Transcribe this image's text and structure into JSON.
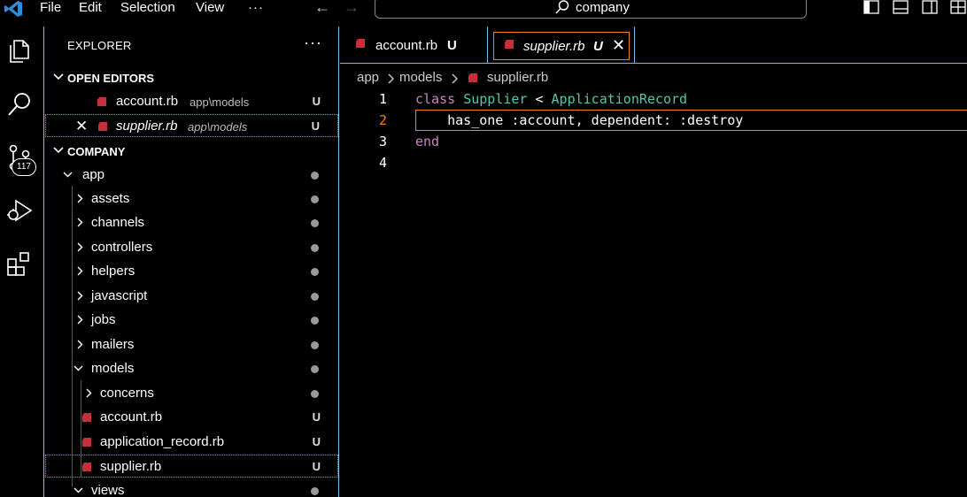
{
  "menu": {
    "items": [
      "File",
      "Edit",
      "Selection",
      "View"
    ],
    "more": "···"
  },
  "search": {
    "text": "company"
  },
  "activity": {
    "source_control_badge": "117"
  },
  "sidebar": {
    "title": "EXPLORER",
    "more": "···",
    "open_editors": {
      "label": "OPEN EDITORS",
      "items": [
        {
          "name": "account.rb",
          "path": "app\\models",
          "status": "U"
        },
        {
          "name": "supplier.rb",
          "path": "app\\models",
          "status": "U"
        }
      ]
    },
    "project": {
      "label": "COMPANY",
      "tree": [
        {
          "name": "app"
        },
        {
          "name": "assets"
        },
        {
          "name": "channels"
        },
        {
          "name": "controllers"
        },
        {
          "name": "helpers"
        },
        {
          "name": "javascript"
        },
        {
          "name": "jobs"
        },
        {
          "name": "mailers"
        },
        {
          "name": "models"
        },
        {
          "name": "concerns"
        },
        {
          "name": "account.rb",
          "status": "U"
        },
        {
          "name": "application_record.rb",
          "status": "U"
        },
        {
          "name": "supplier.rb",
          "status": "U"
        },
        {
          "name": "views"
        }
      ]
    }
  },
  "editor": {
    "tabs": [
      {
        "label": "account.rb",
        "status": "U"
      },
      {
        "label": "supplier.rb",
        "status": "U",
        "close": "✕"
      }
    ],
    "breadcrumb": [
      "app",
      "models",
      "supplier.rb"
    ],
    "line_numbers": [
      "1",
      "2",
      "3",
      "4"
    ],
    "code": {
      "l1_kw": "class",
      "l1_cls": "Supplier",
      "l1_op": "<",
      "l1_base": "ApplicationRecord",
      "l2": "    has_one :account, dependent: :destroy",
      "l3_kw": "end"
    }
  },
  "colors": {
    "accent": "#f38518",
    "border": "#6fc3df",
    "ruby": "#c7303b",
    "keyword": "#c586c0",
    "class": "#4ec9b0"
  }
}
